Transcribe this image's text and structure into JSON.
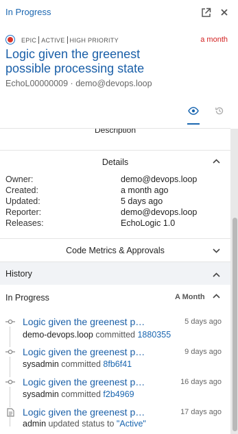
{
  "header": {
    "status": "In Progress",
    "open_icon": "open-in-new-icon",
    "close_icon": "close-icon"
  },
  "issue": {
    "type_icon": "epic-type-icon",
    "tags": [
      "EPIC",
      "ACTIVE",
      "HIGH PRIORITY"
    ],
    "age": "a month",
    "title": "Logic given the greenest possible processing state",
    "id": "EchoL00000009",
    "meta_separator": "·",
    "owner_email": "demo@devops.loop"
  },
  "tabs": [
    {
      "icon": "eye-icon",
      "active": true
    },
    {
      "icon": "history-icon",
      "active": false
    }
  ],
  "sections": {
    "description": "Description",
    "details": "Details",
    "code_metrics": "Code Metrics & Approvals",
    "history": "History"
  },
  "details": [
    {
      "key": "Owner:",
      "value": "demo@devops.loop"
    },
    {
      "key": "Created:",
      "value": "a month ago"
    },
    {
      "key": "Updated:",
      "value": "5 days ago"
    },
    {
      "key": "Reporter:",
      "value": "demo@devops.loop"
    },
    {
      "key": "Releases:",
      "value": "EchoLogic 1.0"
    }
  ],
  "history": {
    "group_label": "In Progress",
    "group_age": "A Month",
    "entries": [
      {
        "icon": "commit-icon",
        "title": "Logic given the greenest possible processing state",
        "time": "5 days ago",
        "who": "demo-devops.loop",
        "action": "committed",
        "ref": "1880355"
      },
      {
        "icon": "commit-icon",
        "title": "Logic given the greenest possible processing state",
        "time": "9 days ago",
        "who": "sysadmin",
        "action": "committed",
        "ref": "8fb6f41"
      },
      {
        "icon": "commit-icon",
        "title": "Logic given the greenest possible processing state",
        "time": "16 days ago",
        "who": "sysadmin",
        "action": "committed",
        "ref": "f2b4969"
      },
      {
        "icon": "document-icon",
        "title": "Logic given the greenest possible processing state",
        "time": "17 days ago",
        "who": "admin",
        "action": "updated status to",
        "ref": "\"Active\""
      }
    ]
  },
  "colors": {
    "accent": "#1a66b0",
    "link": "#1a5fa8",
    "age": "#d21f1f",
    "epic_ring": "#1f6fc5",
    "epic_fill": "#d9342b"
  }
}
